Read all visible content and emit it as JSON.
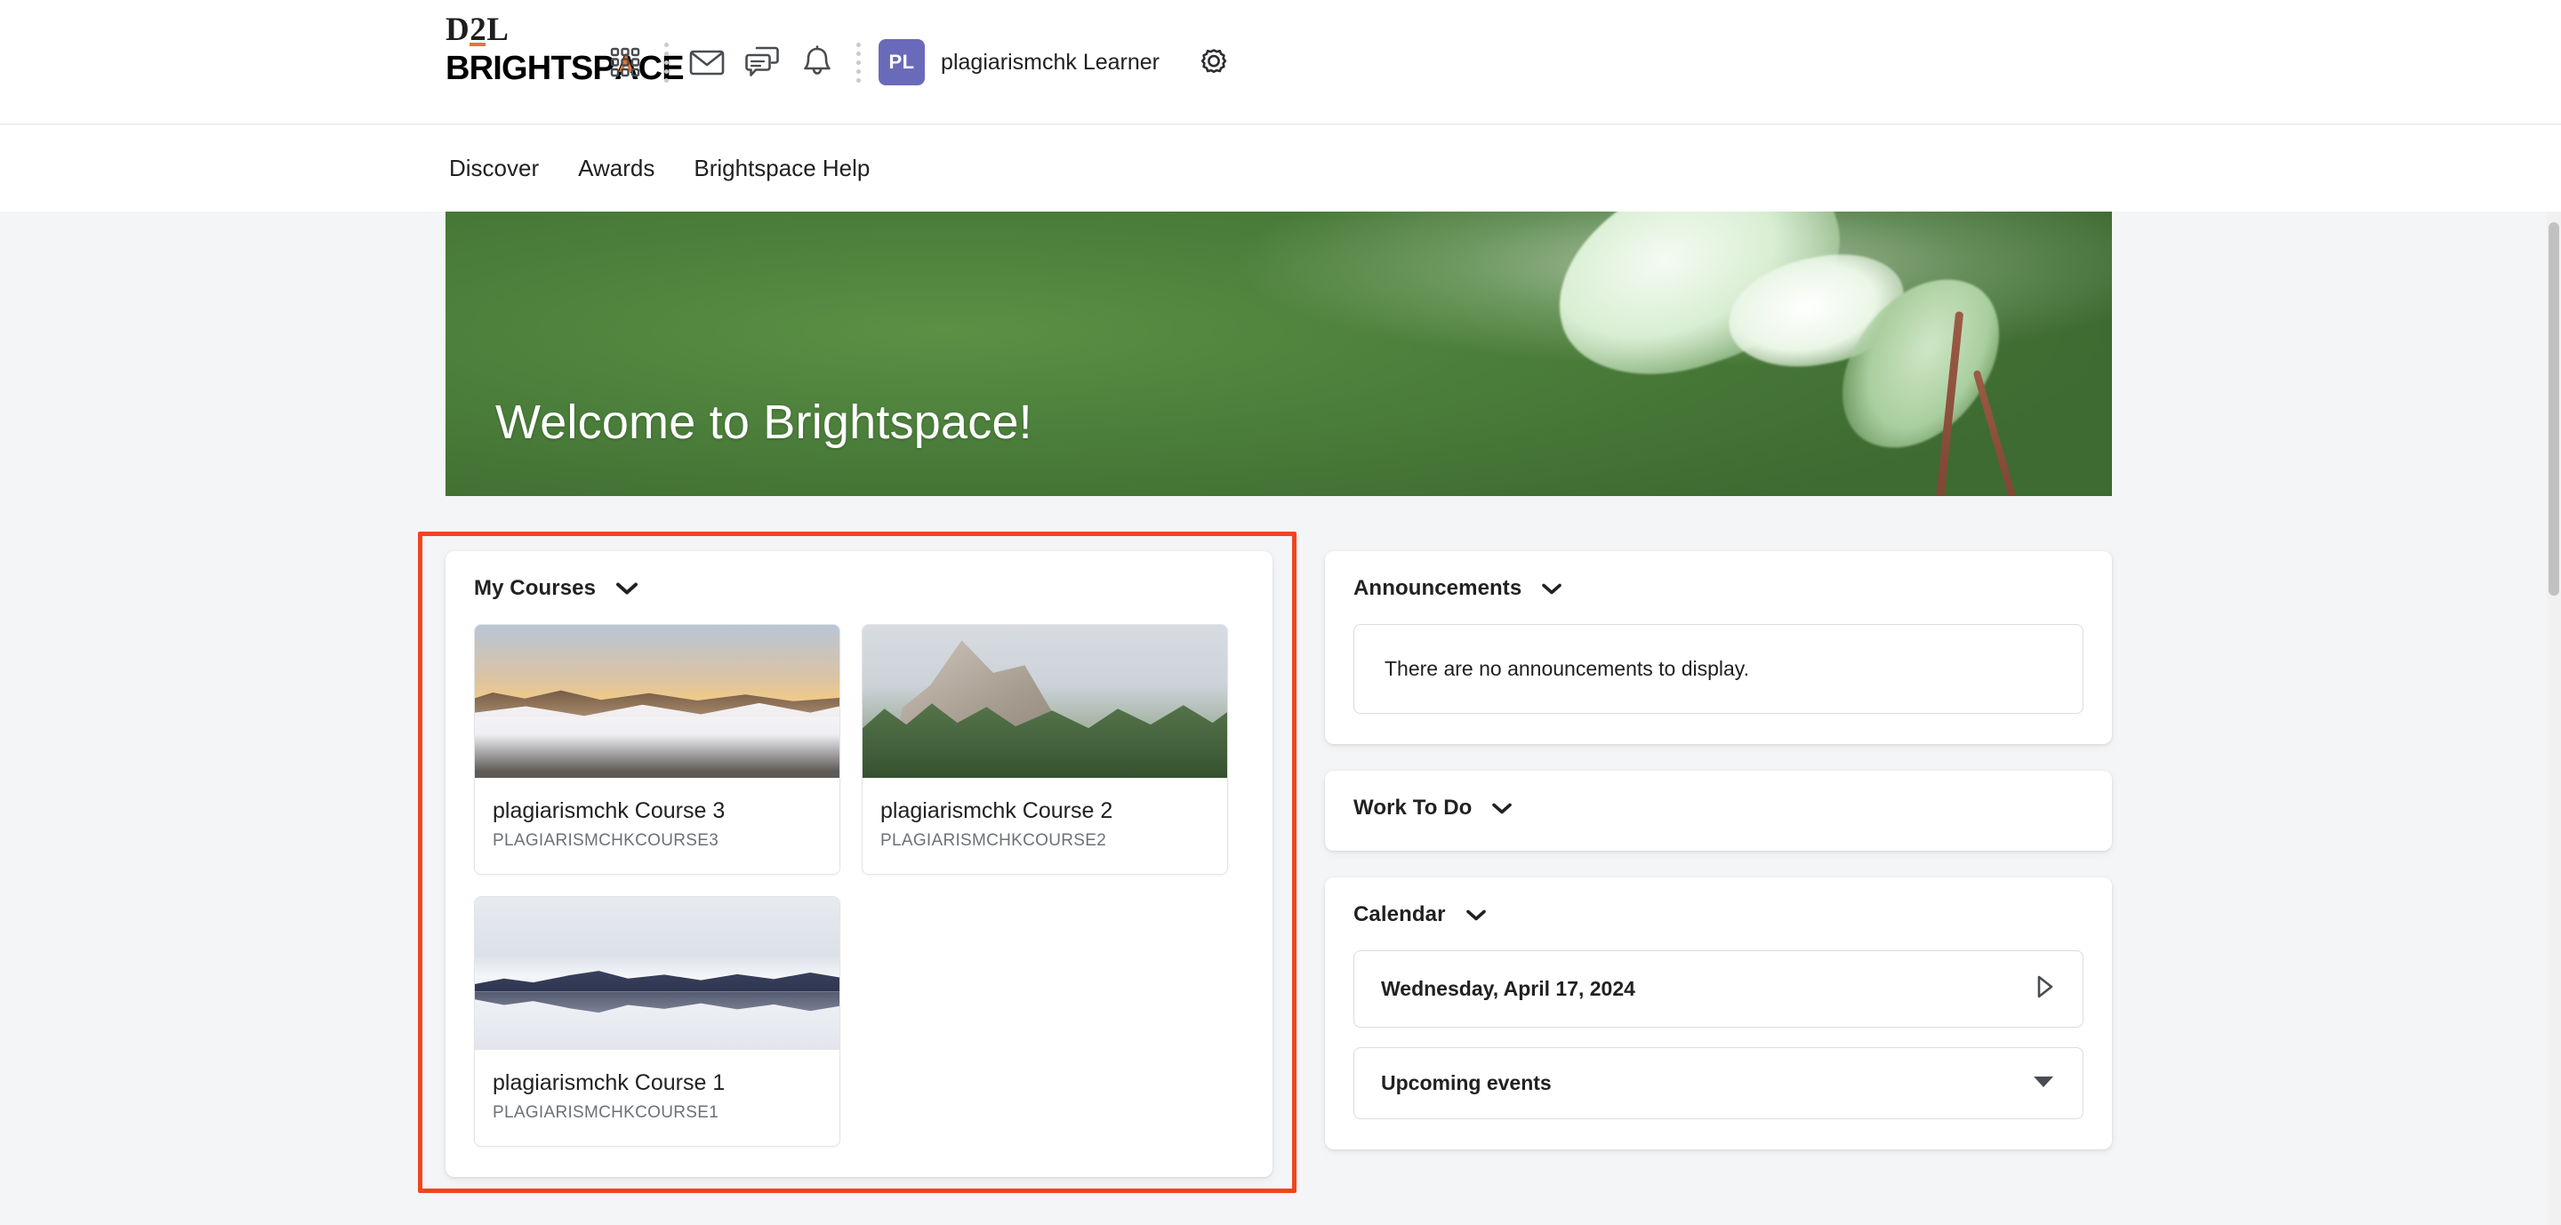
{
  "brand": {
    "logo_top": "D2L",
    "logo_bottom": "BRIGHTSPACE",
    "accent_color": "#E8762C",
    "avatar_color": "#6A6ABA",
    "annotation_color": "#F0451F"
  },
  "header": {
    "icons": [
      {
        "name": "waffle-menu-icon",
        "label": "Course selector"
      },
      {
        "name": "envelope-icon",
        "label": "Email"
      },
      {
        "name": "chat-bubbles-icon",
        "label": "Subscriptions"
      },
      {
        "name": "bell-icon",
        "label": "Notifications"
      },
      {
        "name": "gear-icon",
        "label": "Settings"
      }
    ],
    "avatar_initials": "PL",
    "user_name": "plagiarismchk Learner"
  },
  "nav": {
    "links": [
      {
        "label": "Discover"
      },
      {
        "label": "Awards"
      },
      {
        "label": "Brightspace Help"
      }
    ]
  },
  "banner": {
    "title": "Welcome to Brightspace!"
  },
  "my_courses": {
    "title": "My Courses",
    "courses": [
      {
        "name": "plagiarismchk Course 3",
        "code": "PLAGIARISMCHKCOURSE3",
        "image": "sunrise-valley-fog-photo"
      },
      {
        "name": "plagiarismchk Course 2",
        "code": "PLAGIARISMCHKCOURSE2",
        "image": "rocky-crag-pines-photo"
      },
      {
        "name": "plagiarismchk Course 1",
        "code": "PLAGIARISMCHKCOURSE1",
        "image": "mirrored-snow-mountains-photo"
      }
    ]
  },
  "announcements": {
    "title": "Announcements",
    "empty_message": "There are no announcements to display."
  },
  "work_to_do": {
    "title": "Work To Do"
  },
  "calendar": {
    "title": "Calendar",
    "current_date": "Wednesday, April 17, 2024",
    "upcoming_label": "Upcoming events"
  }
}
